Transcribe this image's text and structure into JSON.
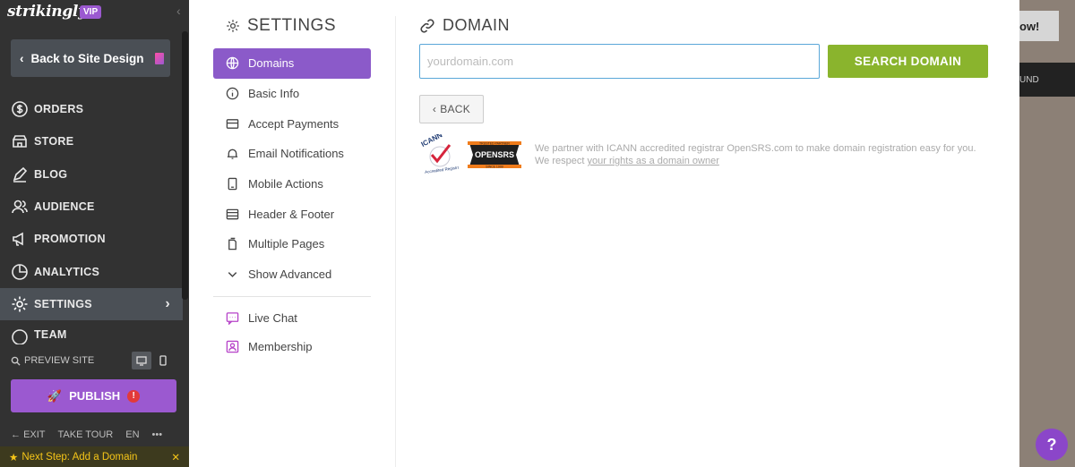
{
  "sidebar": {
    "brand": "strikingly",
    "vip": "VIP",
    "back_label": "Back to Site Design",
    "nav": [
      {
        "label": "ORDERS",
        "icon": "dollar-icon"
      },
      {
        "label": "STORE",
        "icon": "store-icon"
      },
      {
        "label": "BLOG",
        "icon": "pen-icon"
      },
      {
        "label": "AUDIENCE",
        "icon": "audience-icon"
      },
      {
        "label": "PROMOTION",
        "icon": "megaphone-icon"
      },
      {
        "label": "ANALYTICS",
        "icon": "pie-chart-icon"
      },
      {
        "label": "SETTINGS",
        "icon": "gear-icon"
      },
      {
        "label": "TEAM",
        "icon": "team-icon"
      }
    ],
    "preview": "PREVIEW SITE",
    "publish": "PUBLISH",
    "publish_alert": "!",
    "exit": "EXIT",
    "tour": "TAKE TOUR",
    "lang": "EN",
    "more": "•••",
    "next_step": "Next Step: Add a Domain"
  },
  "settings": {
    "title": "SETTINGS",
    "menu": [
      {
        "label": "Domains",
        "icon": "globe-icon"
      },
      {
        "label": "Basic Info",
        "icon": "info-icon"
      },
      {
        "label": "Accept Payments",
        "icon": "card-icon"
      },
      {
        "label": "Email Notifications",
        "icon": "bell-icon"
      },
      {
        "label": "Mobile Actions",
        "icon": "mobile-icon"
      },
      {
        "label": "Header & Footer",
        "icon": "layout-icon"
      },
      {
        "label": "Multiple Pages",
        "icon": "pages-icon"
      },
      {
        "label": "Show Advanced",
        "icon": "chevron-down-icon"
      }
    ],
    "extras": [
      {
        "label": "Live Chat",
        "icon": "chat-icon"
      },
      {
        "label": "Membership",
        "icon": "membership-icon"
      }
    ]
  },
  "domain": {
    "title": "DOMAIN",
    "placeholder": "yourdomain.com",
    "search_label": "SEARCH DOMAIN",
    "back_label": "BACK",
    "partner_text": "We partner with ICANN accredited registrar OpenSRS.com to make domain registration easy for you.",
    "respect_text": "We respect ",
    "rights_link": "your rights as a domain owner",
    "icann_text": "ICANN",
    "icann_sub": "Accredited Registrar",
    "opensrs_text": "OPENSRS",
    "opensrs_top": "TRUSTED PARTNER",
    "opensrs_bottom": "SINCE 1999"
  },
  "background": {
    "button_text": "ow!",
    "button2_text": "UND"
  },
  "help": "?"
}
